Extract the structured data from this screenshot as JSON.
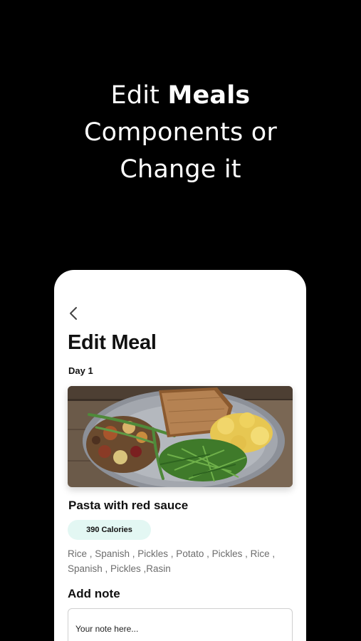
{
  "headline": {
    "line1_pre": "Edit ",
    "line1_bold": "Meals",
    "line2": "Components or",
    "line3": "Change it"
  },
  "screen": {
    "back_icon": "chevron-left-icon",
    "title": "Edit Meal",
    "day": "Day 1",
    "meal": {
      "name": "Pasta with red sauce",
      "calories": "390 Calories",
      "ingredients": "Rice , Spanish , Pickles , Potato , Pickles , Rice , Spanish , Pickles ,Rasin"
    },
    "note": {
      "label": "Add note",
      "placeholder": "Your note here..."
    }
  },
  "colors": {
    "background": "#000000",
    "card": "#ffffff",
    "calorie_badge": "#e3f7f3",
    "ingredients_text": "#6d6d6d"
  }
}
